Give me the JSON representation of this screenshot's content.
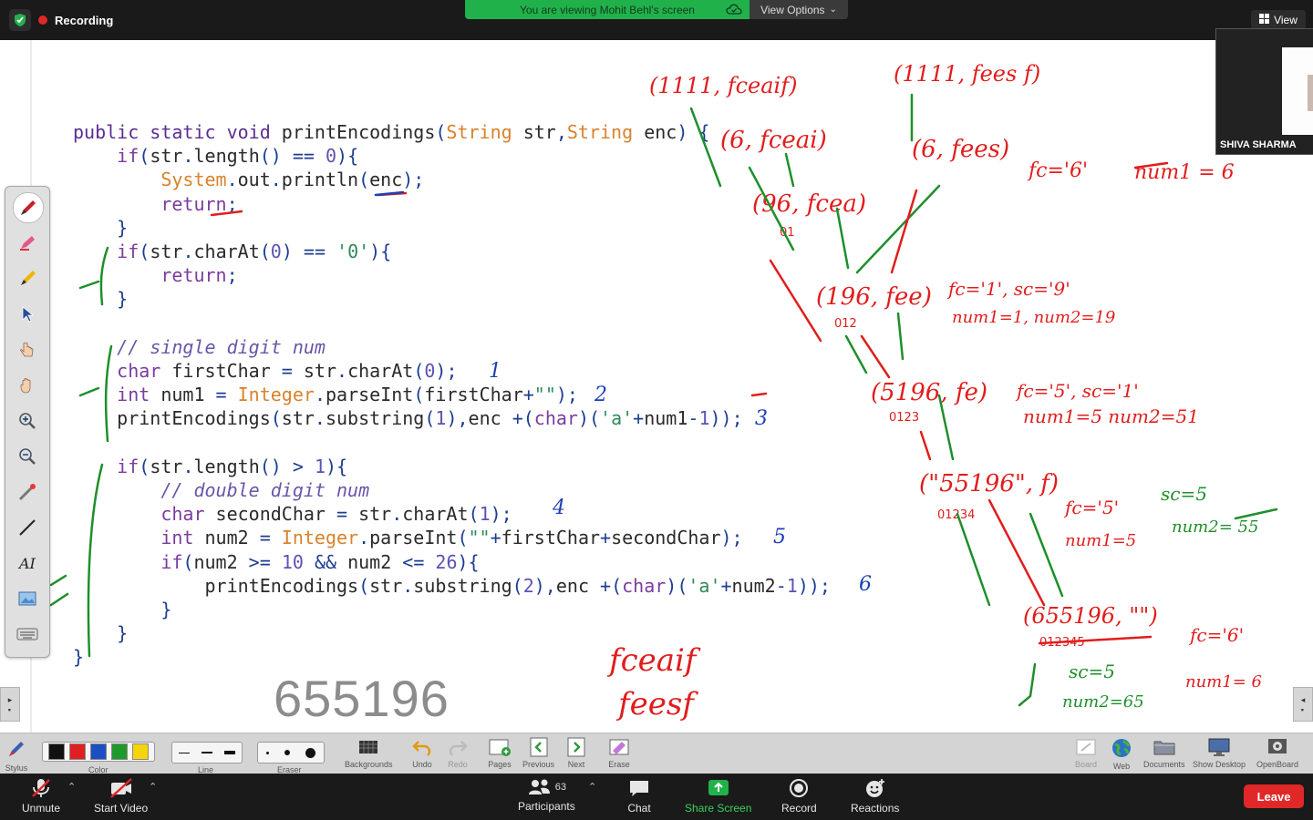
{
  "topbar": {
    "recording_label": "Recording",
    "viewing_banner": "You are viewing Mohit Behl's screen",
    "view_options_label": "View Options",
    "view_label": "View"
  },
  "thumbnail": {
    "participant_name": "SHIVA SHARMA"
  },
  "whiteboard": {
    "big_number": "655196",
    "handwriting": {
      "result_words": [
        "fceaif",
        "feesf"
      ],
      "top_left_call": "(1111, fceaif)",
      "top_right_call": "(1111, fees f)",
      "nodes": [
        "(6, fceai)",
        "(6, fees)",
        "(96, fcea)",
        "(196, fee)",
        "(5196, fe)",
        "(\"55196\", f)",
        "(655196, \"\")"
      ],
      "notes": [
        "fc='6'",
        "num1 = 6",
        "fc='1', sc='9'",
        "num1=1, num2=19",
        "fc='5', sc='1'",
        "num1=5 num2=51",
        "fc='5'",
        "sc=5",
        "num1=5",
        "num2= 55",
        "fc='6'",
        "sc=5",
        "num2=65",
        "num1= 6"
      ],
      "line_numbers": [
        "1",
        "2",
        "3",
        "4",
        "5",
        "6"
      ],
      "index_marks": [
        "01",
        "012",
        "0123",
        "01234",
        "012345"
      ]
    }
  },
  "wb_toolbar": {
    "stylus": "Stylus",
    "color": "Color",
    "line": "Line",
    "eraser": "Eraser",
    "backgrounds": "Backgrounds",
    "undo": "Undo",
    "redo": "Redo",
    "pages": "Pages",
    "previous": "Previous",
    "next": "Next",
    "erase": "Erase",
    "board": "Board",
    "web": "Web",
    "documents": "Documents",
    "show_desktop": "Show Desktop",
    "openboard": "OpenBoard",
    "colors": [
      "#111111",
      "#e02020",
      "#1d4fc4",
      "#1f9a2a",
      "#f6d40c"
    ]
  },
  "zoom_controls": {
    "unmute": "Unmute",
    "start_video": "Start Video",
    "participants": "Participants",
    "participants_count": "63",
    "chat": "Chat",
    "share_screen": "Share Screen",
    "record": "Record",
    "reactions": "Reactions",
    "leave": "Leave"
  },
  "colors": {
    "share_green": "#21b14b",
    "leave_red": "#e02828",
    "ink_red": "#e11d1d",
    "ink_green": "#1e8f2a",
    "ink_blue": "#1d3fb5"
  }
}
